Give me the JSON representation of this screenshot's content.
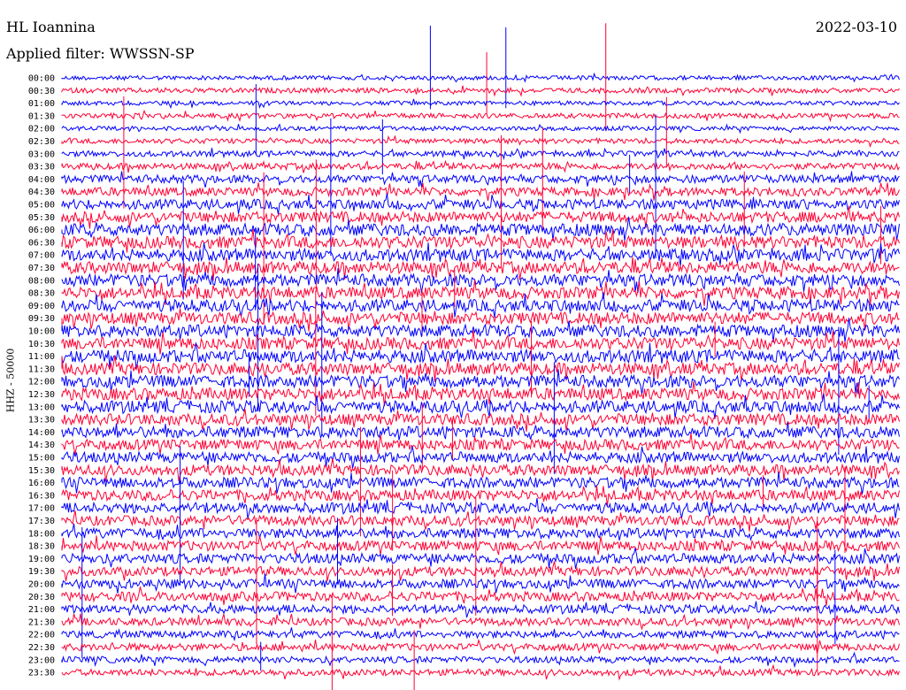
{
  "header": {
    "station": "HL Ioannina",
    "filter": "Applied filter: WWSSN-SP",
    "date": "2022-03-10"
  },
  "chart_data": {
    "type": "line",
    "title": "HL Ioannina",
    "ylabel": "HHZ - 50000",
    "row_labels": [
      "00:00",
      "00:30",
      "01:00",
      "01:30",
      "02:00",
      "02:30",
      "03:00",
      "03:30",
      "04:00",
      "04:30",
      "05:00",
      "05:30",
      "06:00",
      "06:30",
      "07:00",
      "07:30",
      "08:00",
      "08:30",
      "09:00",
      "09:30",
      "10:00",
      "10:30",
      "11:00",
      "11:30",
      "12:00",
      "12:30",
      "13:00",
      "13:30",
      "14:00",
      "14:30",
      "15:00",
      "15:30",
      "16:00",
      "16:30",
      "17:00",
      "17:30",
      "18:00",
      "18:30",
      "19:00",
      "19:30",
      "20:00",
      "20:30",
      "21:00",
      "21:30",
      "22:00",
      "22:30",
      "23:00",
      "23:30"
    ],
    "row_amplitude": [
      0.3,
      0.35,
      0.3,
      0.35,
      0.3,
      0.35,
      0.4,
      0.45,
      0.55,
      0.6,
      0.7,
      0.75,
      0.85,
      0.85,
      0.85,
      0.85,
      0.85,
      0.85,
      0.85,
      0.85,
      0.85,
      0.85,
      0.9,
      0.85,
      0.85,
      0.85,
      0.85,
      0.8,
      0.8,
      0.75,
      0.75,
      0.75,
      0.75,
      0.75,
      0.75,
      0.7,
      0.7,
      0.7,
      0.7,
      0.65,
      0.65,
      0.65,
      0.6,
      0.55,
      0.5,
      0.5,
      0.45,
      0.45
    ],
    "colors": {
      "even": "#0000ff",
      "odd": "#ff0033",
      "text": "#000000",
      "background": "#ffffff"
    }
  }
}
